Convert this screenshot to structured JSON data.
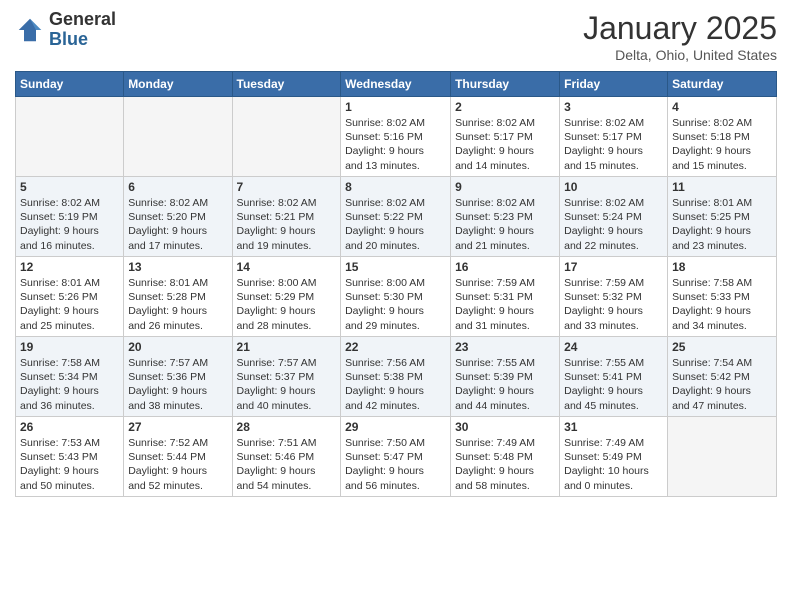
{
  "logo": {
    "general": "General",
    "blue": "Blue"
  },
  "title": "January 2025",
  "subtitle": "Delta, Ohio, United States",
  "days_header": [
    "Sunday",
    "Monday",
    "Tuesday",
    "Wednesday",
    "Thursday",
    "Friday",
    "Saturday"
  ],
  "weeks": [
    [
      {
        "day": "",
        "info": ""
      },
      {
        "day": "",
        "info": ""
      },
      {
        "day": "",
        "info": ""
      },
      {
        "day": "1",
        "info": "Sunrise: 8:02 AM\nSunset: 5:16 PM\nDaylight: 9 hours\nand 13 minutes."
      },
      {
        "day": "2",
        "info": "Sunrise: 8:02 AM\nSunset: 5:17 PM\nDaylight: 9 hours\nand 14 minutes."
      },
      {
        "day": "3",
        "info": "Sunrise: 8:02 AM\nSunset: 5:17 PM\nDaylight: 9 hours\nand 15 minutes."
      },
      {
        "day": "4",
        "info": "Sunrise: 8:02 AM\nSunset: 5:18 PM\nDaylight: 9 hours\nand 15 minutes."
      }
    ],
    [
      {
        "day": "5",
        "info": "Sunrise: 8:02 AM\nSunset: 5:19 PM\nDaylight: 9 hours\nand 16 minutes."
      },
      {
        "day": "6",
        "info": "Sunrise: 8:02 AM\nSunset: 5:20 PM\nDaylight: 9 hours\nand 17 minutes."
      },
      {
        "day": "7",
        "info": "Sunrise: 8:02 AM\nSunset: 5:21 PM\nDaylight: 9 hours\nand 19 minutes."
      },
      {
        "day": "8",
        "info": "Sunrise: 8:02 AM\nSunset: 5:22 PM\nDaylight: 9 hours\nand 20 minutes."
      },
      {
        "day": "9",
        "info": "Sunrise: 8:02 AM\nSunset: 5:23 PM\nDaylight: 9 hours\nand 21 minutes."
      },
      {
        "day": "10",
        "info": "Sunrise: 8:02 AM\nSunset: 5:24 PM\nDaylight: 9 hours\nand 22 minutes."
      },
      {
        "day": "11",
        "info": "Sunrise: 8:01 AM\nSunset: 5:25 PM\nDaylight: 9 hours\nand 23 minutes."
      }
    ],
    [
      {
        "day": "12",
        "info": "Sunrise: 8:01 AM\nSunset: 5:26 PM\nDaylight: 9 hours\nand 25 minutes."
      },
      {
        "day": "13",
        "info": "Sunrise: 8:01 AM\nSunset: 5:28 PM\nDaylight: 9 hours\nand 26 minutes."
      },
      {
        "day": "14",
        "info": "Sunrise: 8:00 AM\nSunset: 5:29 PM\nDaylight: 9 hours\nand 28 minutes."
      },
      {
        "day": "15",
        "info": "Sunrise: 8:00 AM\nSunset: 5:30 PM\nDaylight: 9 hours\nand 29 minutes."
      },
      {
        "day": "16",
        "info": "Sunrise: 7:59 AM\nSunset: 5:31 PM\nDaylight: 9 hours\nand 31 minutes."
      },
      {
        "day": "17",
        "info": "Sunrise: 7:59 AM\nSunset: 5:32 PM\nDaylight: 9 hours\nand 33 minutes."
      },
      {
        "day": "18",
        "info": "Sunrise: 7:58 AM\nSunset: 5:33 PM\nDaylight: 9 hours\nand 34 minutes."
      }
    ],
    [
      {
        "day": "19",
        "info": "Sunrise: 7:58 AM\nSunset: 5:34 PM\nDaylight: 9 hours\nand 36 minutes."
      },
      {
        "day": "20",
        "info": "Sunrise: 7:57 AM\nSunset: 5:36 PM\nDaylight: 9 hours\nand 38 minutes."
      },
      {
        "day": "21",
        "info": "Sunrise: 7:57 AM\nSunset: 5:37 PM\nDaylight: 9 hours\nand 40 minutes."
      },
      {
        "day": "22",
        "info": "Sunrise: 7:56 AM\nSunset: 5:38 PM\nDaylight: 9 hours\nand 42 minutes."
      },
      {
        "day": "23",
        "info": "Sunrise: 7:55 AM\nSunset: 5:39 PM\nDaylight: 9 hours\nand 44 minutes."
      },
      {
        "day": "24",
        "info": "Sunrise: 7:55 AM\nSunset: 5:41 PM\nDaylight: 9 hours\nand 45 minutes."
      },
      {
        "day": "25",
        "info": "Sunrise: 7:54 AM\nSunset: 5:42 PM\nDaylight: 9 hours\nand 47 minutes."
      }
    ],
    [
      {
        "day": "26",
        "info": "Sunrise: 7:53 AM\nSunset: 5:43 PM\nDaylight: 9 hours\nand 50 minutes."
      },
      {
        "day": "27",
        "info": "Sunrise: 7:52 AM\nSunset: 5:44 PM\nDaylight: 9 hours\nand 52 minutes."
      },
      {
        "day": "28",
        "info": "Sunrise: 7:51 AM\nSunset: 5:46 PM\nDaylight: 9 hours\nand 54 minutes."
      },
      {
        "day": "29",
        "info": "Sunrise: 7:50 AM\nSunset: 5:47 PM\nDaylight: 9 hours\nand 56 minutes."
      },
      {
        "day": "30",
        "info": "Sunrise: 7:49 AM\nSunset: 5:48 PM\nDaylight: 9 hours\nand 58 minutes."
      },
      {
        "day": "31",
        "info": "Sunrise: 7:49 AM\nSunset: 5:49 PM\nDaylight: 10 hours\nand 0 minutes."
      },
      {
        "day": "",
        "info": ""
      }
    ]
  ]
}
